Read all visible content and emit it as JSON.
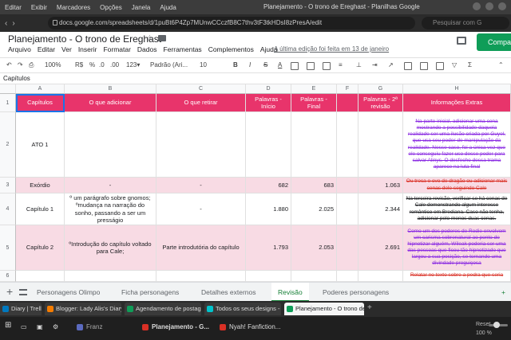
{
  "os": {
    "menu": [
      "Editar",
      "Exibir",
      "Marcadores",
      "Opções",
      "Janela",
      "Ajuda"
    ],
    "window_title": "Planejamento - O trono de Ereghast - Planilhas Google"
  },
  "browser": {
    "url": "docs.google.com/spreadsheets/d/1puBt6P4Zp7MUnwCCczfB8C7thv3tF3tkHDsI8zPresA/edit",
    "search_placeholder": "Pesquisar com G"
  },
  "doc": {
    "title": "Planejamento - O trono de Ereghast",
    "menu": [
      "Arquivo",
      "Editar",
      "Ver",
      "Inserir",
      "Formatar",
      "Dados",
      "Ferramentas",
      "Complementos",
      "Ajuda"
    ],
    "last_edit": "A última edição foi feita em 13 de janeiro",
    "share_label": "Compa"
  },
  "toolbar": {
    "zoom": "100%",
    "currency": "R$",
    "percent": "%",
    "dec0": ".0",
    "dec00": ".00",
    "format123": "123▾",
    "font": "Padrão (Ari...",
    "font_size": "10",
    "bold": "B",
    "italic": "I",
    "strike": "S",
    "text_color": "A"
  },
  "formula_bar": {
    "value": "Capítulos"
  },
  "columns": [
    "A",
    "B",
    "C",
    "D",
    "E",
    "F",
    "G",
    "H"
  ],
  "rows": {
    "header": {
      "num": "1",
      "a": "Capítulos",
      "b": "O que adicionar",
      "c": "O que retirar",
      "d": "Palavras - Início",
      "e": "Palavras - Final",
      "f": "",
      "g": "Palavras - 2ª revisão",
      "h": "Informações Extras"
    },
    "r2": {
      "num": "2",
      "a": "ATO 1",
      "b": "",
      "c": "",
      "d": "",
      "e": "",
      "g": "",
      "h": "Na parte inicial, adicionar uma cena mostrando a possibilidade daquela realidade ser uma ilusão criada por Guyel, que usa seu poder de manipulação da realidade. Nesse caso, foi a única vez que ele conseguiu fazer uso desse poder para salvar Alinys. O desfecho dessa trama aparece na luta final"
    },
    "r3": {
      "num": "3",
      "a": "Exórdio",
      "b": "-",
      "c": "-",
      "d": "682",
      "e": "683",
      "g": "1.063",
      "h": "Ou troca o ovo de dragão ou adicionar mais cenas dele seguindo Cale"
    },
    "r4": {
      "num": "4",
      "a": "Capítulo 1",
      "b": "º um parágrafo sobre gnomos; ºmudança na narração do sonho, passando a ser um presságio",
      "c": "-",
      "d": "1.880",
      "e": "2.025",
      "g": "2.344",
      "h": "Na terceira revisão, verificar se há cenas de Cale demonstrando algum interesse romântico em Brediana. Caso não tenha, adicionar pelo menos duas cenas."
    },
    "r5": {
      "num": "5",
      "a": "Capítulo 2",
      "b": "ºIntrodução do capítulo voltado para Cale;",
      "c": "Parte introdutória do capítulo",
      "d": "1.793",
      "e": "2.053",
      "g": "2.691",
      "h": "Como um dos poderes de Rodie envolvem um carisma sobrenatural ao ponto de hipnotizar alguém, Wileak poderia ser uma das pessoas que ficou tão hipnotizado que largou a sua posição, se tornando uma divindade preguiçosa"
    },
    "r6": {
      "num": "6",
      "h": "Relatar no texto sobre a pedra que seria"
    }
  },
  "sheet_tabs": [
    "Personagens Olimpo",
    "Ficha personagens",
    "Detalhes externos",
    "Revisão",
    "Poderes personagens"
  ],
  "active_sheet": "Revisão",
  "browser_tabs": [
    {
      "label": "Diary | Trello",
      "color": "#0079bf"
    },
    {
      "label": "Blogger: Lady Alis's Diary",
      "color": "#f57c00"
    },
    {
      "label": "Agendamento de postage",
      "color": "#0f9d58"
    },
    {
      "label": "Todos os seus designs - Ca",
      "color": "#00c4cc"
    },
    {
      "label": "Planejamento - O trono de",
      "color": "#0f9d58"
    }
  ],
  "taskbar": {
    "items": [
      "Franz",
      "Planejamento - G...",
      "Nyah! Fanfiction..."
    ],
    "reset": "Reset",
    "zoom": "100 %"
  },
  "colors": {
    "header_pink": "#e8346b",
    "row_pink": "#f8dbe4",
    "strike_purple": "#8a2be2",
    "active_tab_green": "#188038"
  }
}
